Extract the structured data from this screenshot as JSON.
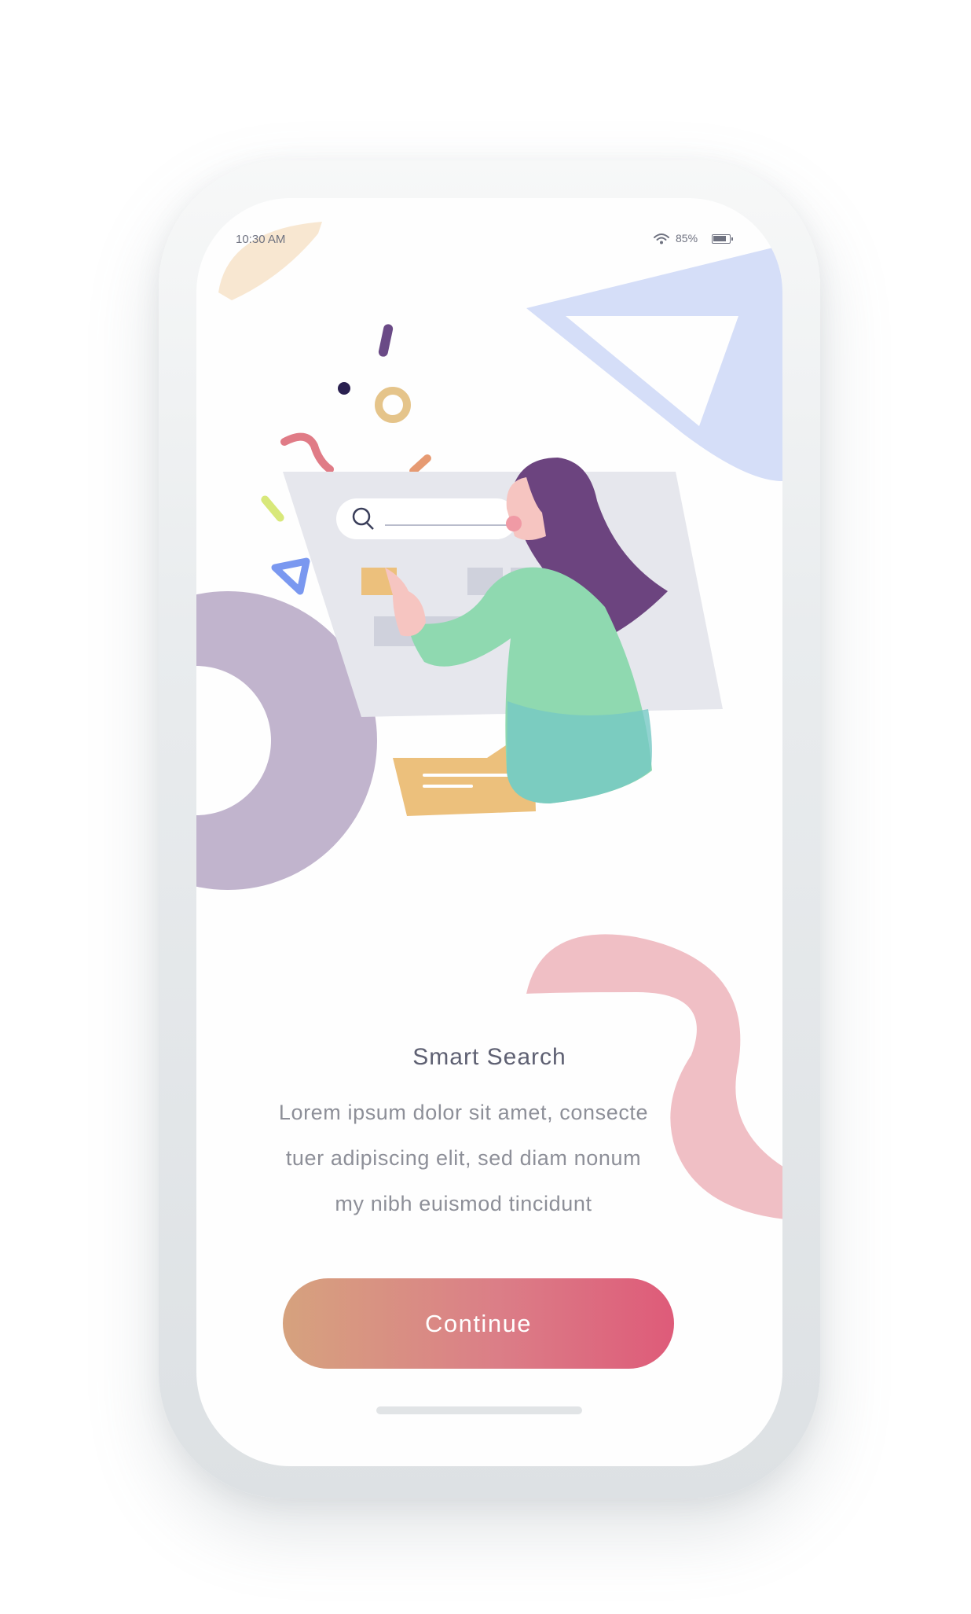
{
  "status_bar": {
    "time": "10:30 AM",
    "battery_percent": "85%",
    "battery_level": 0.85
  },
  "onboarding": {
    "title": "Smart Search",
    "description_lines": [
      "Lorem ipsum dolor sit amet, consecte",
      "tuer adipiscing elit, sed diam nonum",
      "my nibh euismod tincidunt"
    ],
    "continue_label": "Continue"
  },
  "colors": {
    "button_gradient_start": "#d6a27e",
    "button_gradient_end": "#de5b79",
    "title_text": "#5e6072",
    "body_text": "#8d8f98"
  },
  "icons": [
    "wifi-icon",
    "battery-icon",
    "search-icon"
  ]
}
